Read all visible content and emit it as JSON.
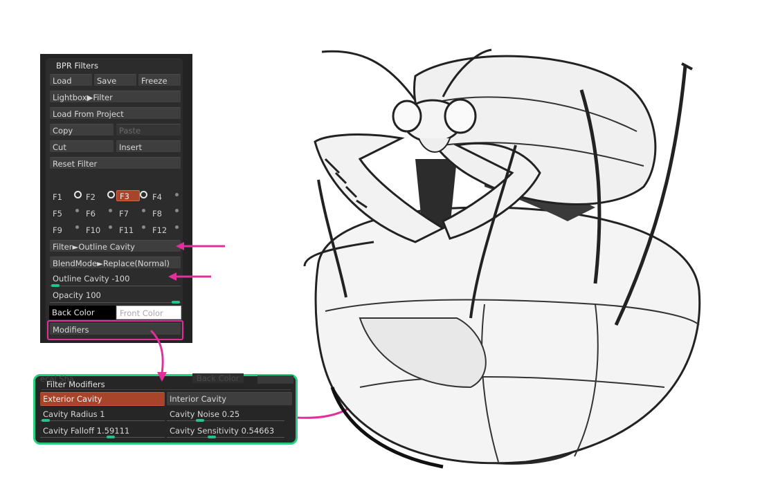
{
  "bpr_panel": {
    "title": "BPR Filters",
    "load_label": "Load",
    "save_label": "Save",
    "freeze_label": "Freeze",
    "lightbox_label": "Lightbox▶Filter",
    "load_from_project_label": "Load From Project",
    "copy_label": "Copy",
    "paste_label": "Paste",
    "cut_label": "Cut",
    "insert_label": "Insert",
    "reset_filter_label": "Reset Filter",
    "filter_slots": [
      "F1",
      "F2",
      "F3",
      "F4",
      "F5",
      "F6",
      "F7",
      "F8",
      "F9",
      "F10",
      "F11",
      "F12"
    ],
    "selected_slot": "F3",
    "filter_label": "Filter►Outline Cavity",
    "blendmode_label": "BlendMode►Replace(Normal)",
    "outline_cavity": {
      "label": "Outline Cavity",
      "value": "-100",
      "fraction": 0.0
    },
    "opacity": {
      "label": "Opacity",
      "value": "100",
      "fraction": 1.0
    },
    "back_color_label": "Back Color",
    "front_color_label": "Front Color",
    "modifiers_label": "Modifiers"
  },
  "filter_modifiers": {
    "ghost_left": "ecal Sha",
    "ghost_right": "Back Color",
    "title": "Filter Modifiers",
    "exterior_cavity_label": "Exterior Cavity",
    "interior_cavity_label": "Interior Cavity",
    "cavity_radius": {
      "label": "Cavity Radius",
      "value": "1",
      "fraction": 0.02
    },
    "cavity_noise": {
      "label": "Cavity Noise",
      "value": "0.25",
      "fraction": 0.25
    },
    "cavity_falloff": {
      "label": "Cavity Falloff",
      "value": "1.59111",
      "fraction": 0.58
    },
    "cavity_sensitivity": {
      "label": "Cavity Sensitivity",
      "value": "0.54663",
      "fraction": 0.38
    }
  },
  "colors": {
    "accent_orange": "#a7442a",
    "slider_knob": "#25c28a",
    "annotation_pink": "#e0319a",
    "highlight_green": "#26d080"
  },
  "render": {
    "subject": "praying-mantis-on-ball-render"
  }
}
